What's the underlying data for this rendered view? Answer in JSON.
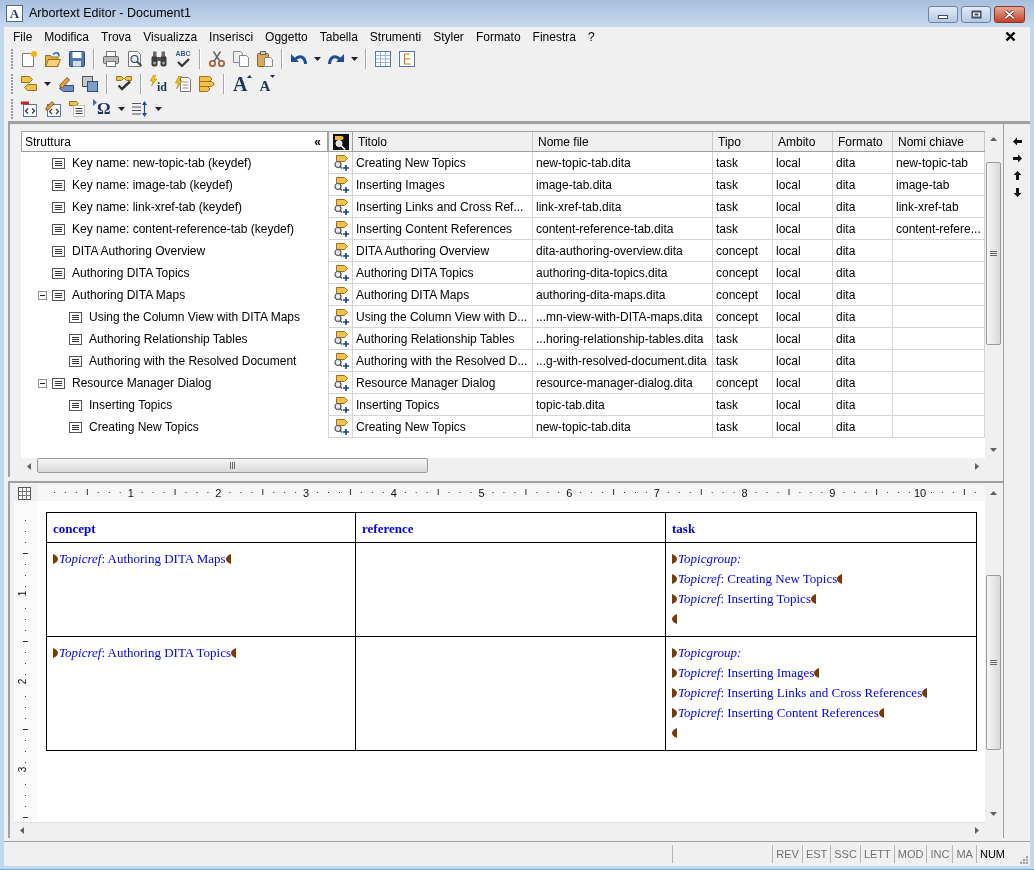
{
  "window": {
    "logo": "A",
    "title": "Arbortext Editor - Document1"
  },
  "menu": [
    "File",
    "Modifica",
    "Trova",
    "Visualizza",
    "Inserisci",
    "Oggetto",
    "Tabella",
    "Strumenti",
    "Styler",
    "Formato",
    "Finestra",
    "?"
  ],
  "toolbars": [
    [
      {
        "kind": "new"
      },
      {
        "kind": "open"
      },
      {
        "kind": "save"
      },
      {
        "kind": "separator"
      },
      {
        "kind": "print"
      },
      {
        "kind": "preview"
      },
      {
        "kind": "find"
      },
      {
        "kind": "spell",
        "glyph": "ABC"
      },
      {
        "kind": "separator"
      },
      {
        "kind": "cut"
      },
      {
        "kind": "copy"
      },
      {
        "kind": "paste"
      },
      {
        "kind": "separator"
      },
      {
        "kind": "undo"
      },
      {
        "kind": "dropdown"
      },
      {
        "kind": "redo"
      },
      {
        "kind": "dropdown"
      },
      {
        "kind": "separator"
      },
      {
        "kind": "table"
      },
      {
        "kind": "structure"
      }
    ],
    [
      {
        "kind": "tag"
      },
      {
        "kind": "dropdown"
      },
      {
        "kind": "edit_tag"
      },
      {
        "kind": "overlap"
      },
      {
        "kind": "separator"
      },
      {
        "kind": "check_tags"
      },
      {
        "kind": "separator"
      },
      {
        "kind": "id",
        "glyph": "id"
      },
      {
        "kind": "generate"
      },
      {
        "kind": "tag_stack"
      },
      {
        "kind": "separator"
      },
      {
        "kind": "grow",
        "glyph": "A"
      },
      {
        "kind": "shrink",
        "glyph": "A"
      }
    ],
    [
      {
        "kind": "code_doc"
      },
      {
        "kind": "edit_code"
      },
      {
        "kind": "tag_list"
      },
      {
        "kind": "omega",
        "glyph": "Ω"
      },
      {
        "kind": "dropdown"
      },
      {
        "kind": "spacing"
      },
      {
        "kind": "dropdown"
      }
    ]
  ],
  "structure": {
    "title": "Struttura",
    "collapse": "«",
    "items": [
      {
        "label": "Key name: new-topic-tab (keydef)"
      },
      {
        "label": "Key name: image-tab (keydef)"
      },
      {
        "label": "Key name: link-xref-tab (keydef)"
      },
      {
        "label": "Key name: content-reference-tab (keydef)"
      },
      {
        "label": "DITA Authoring Overview"
      },
      {
        "label": "Authoring DITA Topics"
      },
      {
        "label": "Authoring DITA Maps",
        "expanded": true,
        "children": [
          {
            "label": "Using the Column View with DITA Maps"
          },
          {
            "label": "Authoring Relationship Tables"
          },
          {
            "label": "Authoring with the Resolved Document"
          }
        ]
      },
      {
        "label": "Resource Manager Dialog",
        "expanded": true,
        "children": [
          {
            "label": "Inserting Topics"
          },
          {
            "label": "Creating New Topics"
          }
        ]
      }
    ]
  },
  "table": {
    "columns": [
      "Titolo",
      "Nome file",
      "Tipo",
      "Ambito",
      "Formato",
      "Nomi chiave"
    ],
    "rows": [
      {
        "title": "Creating New Topics",
        "file_name": "new-topic-tab.dita",
        "type": "task",
        "scope": "local",
        "format": "dita",
        "key_names": "new-topic-tab"
      },
      {
        "title": "Inserting Images",
        "file_name": "image-tab.dita",
        "type": "task",
        "scope": "local",
        "format": "dita",
        "key_names": "image-tab"
      },
      {
        "title": "Inserting Links and Cross Ref...",
        "file_name": "link-xref-tab.dita",
        "type": "task",
        "scope": "local",
        "format": "dita",
        "key_names": "link-xref-tab"
      },
      {
        "title": "Inserting Content References",
        "file_name": "content-reference-tab.dita",
        "type": "task",
        "scope": "local",
        "format": "dita",
        "key_names": "content-refere..."
      },
      {
        "title": "DITA Authoring Overview",
        "file_name": "dita-authoring-overview.dita",
        "type": "concept",
        "scope": "local",
        "format": "dita"
      },
      {
        "title": "Authoring DITA Topics",
        "file_name": "authoring-dita-topics.dita",
        "type": "concept",
        "scope": "local",
        "format": "dita"
      },
      {
        "title": "Authoring DITA Maps",
        "file_name": "authoring-dita-maps.dita",
        "type": "concept",
        "scope": "local",
        "format": "dita"
      },
      {
        "title": "Using the Column View with D...",
        "file_name": "...mn-view-with-DITA-maps.dita",
        "type": "concept",
        "scope": "local",
        "format": "dita"
      },
      {
        "title": "Authoring Relationship Tables",
        "file_name": "...horing-relationship-tables.dita",
        "type": "task",
        "scope": "local",
        "format": "dita"
      },
      {
        "title": "Authoring with the Resolved D...",
        "file_name": "...g-with-resolved-document.dita",
        "type": "task",
        "scope": "local",
        "format": "dita"
      },
      {
        "title": "Resource Manager Dialog",
        "file_name": "resource-manager-dialog.dita",
        "type": "concept",
        "scope": "local",
        "format": "dita"
      },
      {
        "title": "Inserting Topics",
        "file_name": "topic-tab.dita",
        "type": "task",
        "scope": "local",
        "format": "dita"
      },
      {
        "title": "Creating New Topics",
        "file_name": "new-topic-tab.dita",
        "type": "task",
        "scope": "local",
        "format": "dita"
      }
    ]
  },
  "ruler": {
    "marks": [
      "1",
      "2",
      "3",
      "4",
      "5",
      "6",
      "7",
      "8",
      "9",
      "10"
    ],
    "side_marks": [
      "1",
      "2",
      "3"
    ]
  },
  "document": {
    "columns": [
      "concept",
      "reference",
      "task"
    ],
    "rows": [
      {
        "cells": [
          {
            "entries": [
              {
                "kind": "topicref",
                "text": "*Topicref*: Authoring DITA Maps"
              }
            ]
          },
          {},
          {
            "entries": [
              {
                "kind": "topicgroup",
                "text": "Topicgroup:",
                "children": [
                  {
                    "kind": "topicref",
                    "text": "*Topicref*: Creating New Topics"
                  },
                  {
                    "kind": "topicref",
                    "text": "*Topicref*: Inserting Topics"
                  }
                ]
              }
            ]
          }
        ]
      },
      {
        "cells": [
          {
            "entries": [
              {
                "kind": "topicref",
                "text": "*Topicref*: Authoring DITA Topics"
              }
            ]
          },
          {},
          {
            "entries": [
              {
                "kind": "topicgroup",
                "text": "Topicgroup:",
                "children": [
                  {
                    "kind": "topicref",
                    "text": "*Topicref*: Inserting Images"
                  },
                  {
                    "kind": "topicref",
                    "text": "*Topicref*: Inserting Links and Cross References"
                  },
                  {
                    "kind": "topicref",
                    "text": "*Topicref*: Inserting Content References"
                  }
                ]
              }
            ]
          }
        ]
      }
    ]
  },
  "status_bar": [
    {
      "label": "REV",
      "on": false
    },
    {
      "label": "EST",
      "on": false
    },
    {
      "label": "SSC",
      "on": false
    },
    {
      "label": "LETT",
      "on": false
    },
    {
      "label": "MOD",
      "on": false
    },
    {
      "label": "INC",
      "on": false
    },
    {
      "label": "MA",
      "on": false
    },
    {
      "label": "NUM",
      "on": true
    }
  ]
}
